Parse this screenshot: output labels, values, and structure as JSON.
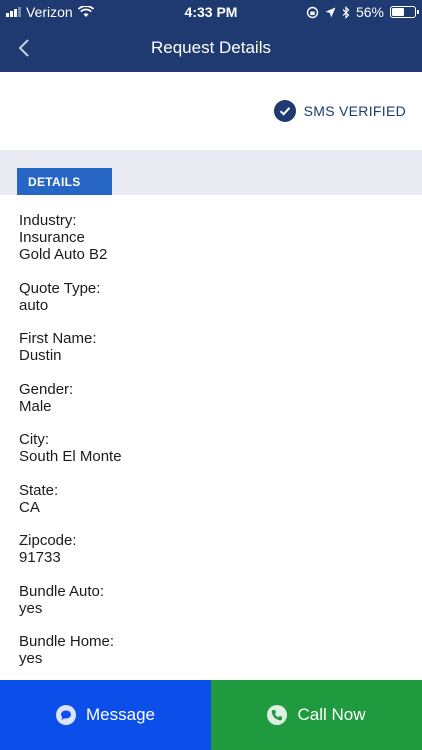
{
  "status_bar": {
    "carrier": "Verizon",
    "time": "4:33 PM",
    "battery_percent": "56%",
    "battery_level": 0.56,
    "icons": [
      "signal-icon",
      "wifi-icon",
      "screen-lock-icon",
      "location-icon",
      "bluetooth-icon",
      "battery-icon"
    ]
  },
  "header": {
    "title": "Request Details",
    "back_icon": "chevron-left-icon"
  },
  "verification": {
    "label": "SMS VERIFIED",
    "icon": "check-circle-icon"
  },
  "details_tab": {
    "label": "DETAILS"
  },
  "fields": [
    {
      "label": "Industry:",
      "value": "Insurance",
      "extra": "Gold Auto B2"
    },
    {
      "label": "Quote Type:",
      "value": "auto"
    },
    {
      "label": "First Name:",
      "value": "Dustin"
    },
    {
      "label": "Gender:",
      "value": "Male"
    },
    {
      "label": "City:",
      "value": "South El Monte"
    },
    {
      "label": "State:",
      "value": "CA"
    },
    {
      "label": "Zipcode:",
      "value": "91733"
    },
    {
      "label": "Bundle Auto:",
      "value": "yes"
    },
    {
      "label": "Bundle Home:",
      "value": "yes"
    }
  ],
  "actions": {
    "message_label": "Message",
    "call_label": "Call Now"
  },
  "colors": {
    "header_bg": "#1e3a70",
    "tab_bg": "#2866c6",
    "message_bg": "#0c4eea",
    "call_bg": "#1f9a3e",
    "band_bg": "#e9eaf2"
  }
}
